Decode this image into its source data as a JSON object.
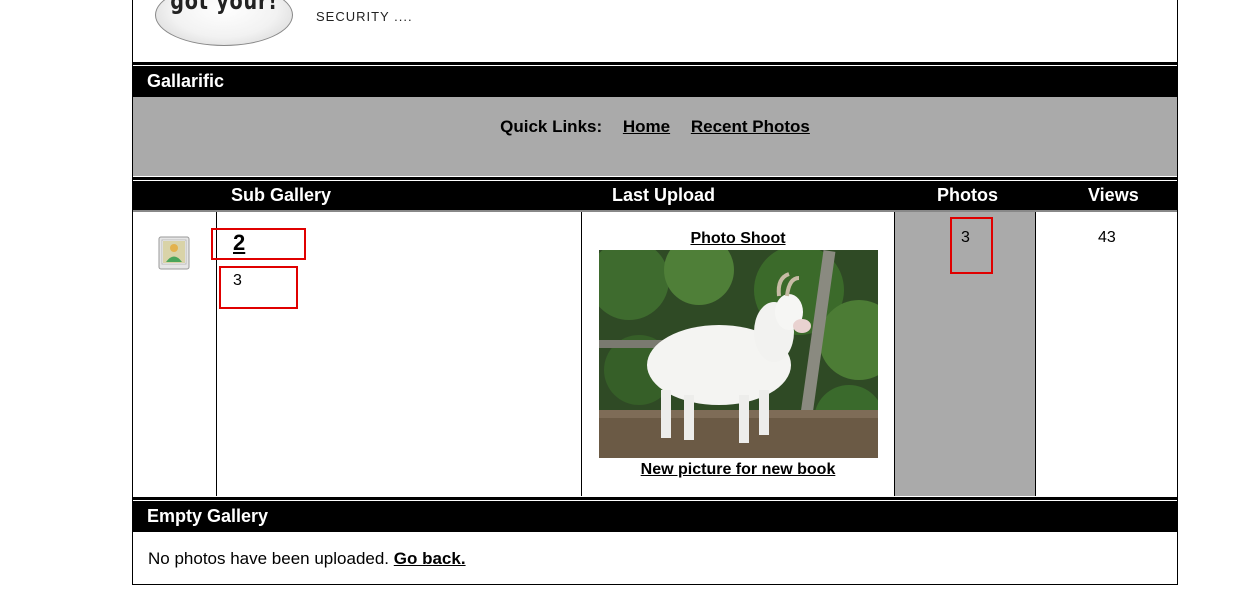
{
  "header": {
    "logo_text": "got your!",
    "tagline": "SECURITY ...."
  },
  "gallery_bar": {
    "title": "Gallarific"
  },
  "quick_links": {
    "label": "Quick Links:",
    "home": "Home",
    "recent": "Recent Photos"
  },
  "table": {
    "headers": [
      "Sub Gallery",
      "Last Upload",
      "Photos",
      "Views"
    ],
    "row": {
      "sub_gallery_name": "2",
      "sub_gallery_count": "3",
      "photo_title": "Photo Shoot",
      "photo_caption": "New picture for new book",
      "photos": "3",
      "views": "43"
    }
  },
  "empty_bar": {
    "title": "Empty Gallery"
  },
  "empty_message": {
    "text": "No photos have been uploaded.",
    "link": "Go back."
  },
  "colors": {
    "bar": "#000000",
    "panel": "#aaaaaa",
    "highlight": "#e00000"
  }
}
